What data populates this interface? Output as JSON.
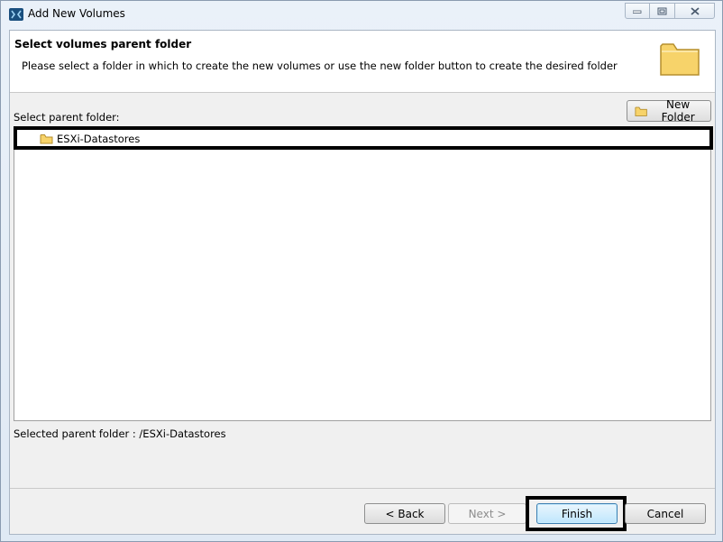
{
  "window": {
    "title": "Add New Volumes"
  },
  "header": {
    "title": "Select volumes parent folder",
    "description": "Please select a folder in which to create the new volumes or use the new folder button to create the desired folder",
    "icon": "folder-icon"
  },
  "tree": {
    "label": "Select parent folder:",
    "new_folder_label": "New Folder",
    "items": [
      {
        "label": "ESXi-Datastores",
        "icon": "folder-icon"
      }
    ]
  },
  "selected": {
    "text": "Selected parent folder : /ESXi-Datastores"
  },
  "buttons": {
    "back": "< Back",
    "next": "Next >",
    "finish": "Finish",
    "cancel": "Cancel"
  },
  "colors": {
    "folder": "#f7d36a",
    "accent": "#3c7fb1"
  }
}
